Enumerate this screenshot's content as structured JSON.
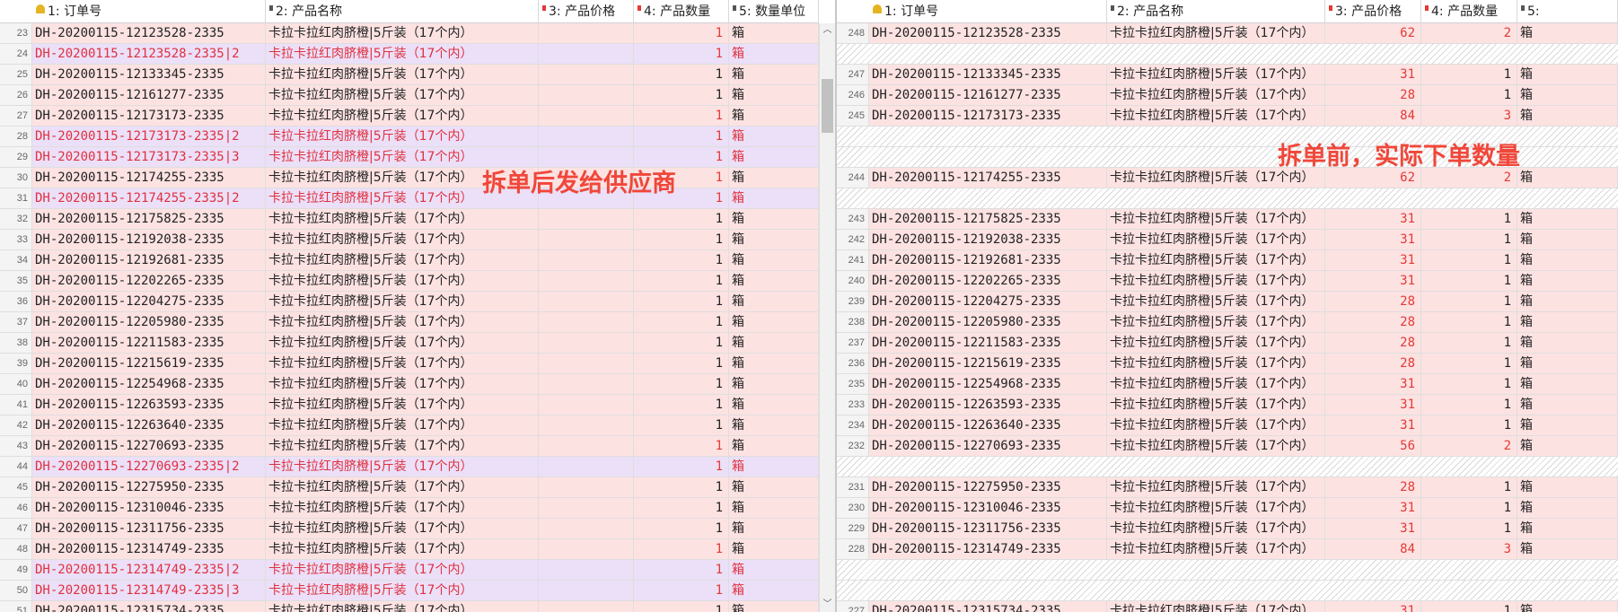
{
  "left": {
    "headers": [
      "1: 订单号",
      "2: 产品名称",
      "3: 产品价格",
      "4: 产品数量",
      "5: 数量单位"
    ],
    "rows": [
      {
        "n": "23",
        "order": "DH-20200115-12123528-2335",
        "name": "卡拉卡拉红肉脐橙|5斤装（17个内）",
        "price": "",
        "qty": "1",
        "unit": "箱",
        "split": false,
        "red_qty": true
      },
      {
        "n": "24",
        "order": "DH-20200115-12123528-2335|2",
        "name": "卡拉卡拉红肉脐橙|5斤装（17个内）",
        "price": "",
        "qty": "1",
        "unit": "箱",
        "split": true,
        "red_qty": true
      },
      {
        "n": "25",
        "order": "DH-20200115-12133345-2335",
        "name": "卡拉卡拉红肉脐橙|5斤装（17个内）",
        "price": "",
        "qty": "1",
        "unit": "箱",
        "split": false,
        "red_qty": false
      },
      {
        "n": "26",
        "order": "DH-20200115-12161277-2335",
        "name": "卡拉卡拉红肉脐橙|5斤装（17个内）",
        "price": "",
        "qty": "1",
        "unit": "箱",
        "split": false,
        "red_qty": false
      },
      {
        "n": "27",
        "order": "DH-20200115-12173173-2335",
        "name": "卡拉卡拉红肉脐橙|5斤装（17个内）",
        "price": "",
        "qty": "1",
        "unit": "箱",
        "split": false,
        "red_qty": true
      },
      {
        "n": "28",
        "order": "DH-20200115-12173173-2335|2",
        "name": "卡拉卡拉红肉脐橙|5斤装（17个内）",
        "price": "",
        "qty": "1",
        "unit": "箱",
        "split": true,
        "red_qty": true
      },
      {
        "n": "29",
        "order": "DH-20200115-12173173-2335|3",
        "name": "卡拉卡拉红肉脐橙|5斤装（17个内）",
        "price": "",
        "qty": "1",
        "unit": "箱",
        "split": true,
        "red_qty": true
      },
      {
        "n": "30",
        "order": "DH-20200115-12174255-2335",
        "name": "卡拉卡拉红肉脐橙|5斤装（17个内）",
        "price": "",
        "qty": "1",
        "unit": "箱",
        "split": false,
        "red_qty": true
      },
      {
        "n": "31",
        "order": "DH-20200115-12174255-2335|2",
        "name": "卡拉卡拉红肉脐橙|5斤装（17个内）",
        "price": "",
        "qty": "1",
        "unit": "箱",
        "split": true,
        "red_qty": true
      },
      {
        "n": "32",
        "order": "DH-20200115-12175825-2335",
        "name": "卡拉卡拉红肉脐橙|5斤装（17个内）",
        "price": "",
        "qty": "1",
        "unit": "箱",
        "split": false,
        "red_qty": false
      },
      {
        "n": "33",
        "order": "DH-20200115-12192038-2335",
        "name": "卡拉卡拉红肉脐橙|5斤装（17个内）",
        "price": "",
        "qty": "1",
        "unit": "箱",
        "split": false,
        "red_qty": false
      },
      {
        "n": "34",
        "order": "DH-20200115-12192681-2335",
        "name": "卡拉卡拉红肉脐橙|5斤装（17个内）",
        "price": "",
        "qty": "1",
        "unit": "箱",
        "split": false,
        "red_qty": false
      },
      {
        "n": "35",
        "order": "DH-20200115-12202265-2335",
        "name": "卡拉卡拉红肉脐橙|5斤装（17个内）",
        "price": "",
        "qty": "1",
        "unit": "箱",
        "split": false,
        "red_qty": false
      },
      {
        "n": "36",
        "order": "DH-20200115-12204275-2335",
        "name": "卡拉卡拉红肉脐橙|5斤装（17个内）",
        "price": "",
        "qty": "1",
        "unit": "箱",
        "split": false,
        "red_qty": false
      },
      {
        "n": "37",
        "order": "DH-20200115-12205980-2335",
        "name": "卡拉卡拉红肉脐橙|5斤装（17个内）",
        "price": "",
        "qty": "1",
        "unit": "箱",
        "split": false,
        "red_qty": false
      },
      {
        "n": "38",
        "order": "DH-20200115-12211583-2335",
        "name": "卡拉卡拉红肉脐橙|5斤装（17个内）",
        "price": "",
        "qty": "1",
        "unit": "箱",
        "split": false,
        "red_qty": false
      },
      {
        "n": "39",
        "order": "DH-20200115-12215619-2335",
        "name": "卡拉卡拉红肉脐橙|5斤装（17个内）",
        "price": "",
        "qty": "1",
        "unit": "箱",
        "split": false,
        "red_qty": false
      },
      {
        "n": "40",
        "order": "DH-20200115-12254968-2335",
        "name": "卡拉卡拉红肉脐橙|5斤装（17个内）",
        "price": "",
        "qty": "1",
        "unit": "箱",
        "split": false,
        "red_qty": false
      },
      {
        "n": "41",
        "order": "DH-20200115-12263593-2335",
        "name": "卡拉卡拉红肉脐橙|5斤装（17个内）",
        "price": "",
        "qty": "1",
        "unit": "箱",
        "split": false,
        "red_qty": false
      },
      {
        "n": "42",
        "order": "DH-20200115-12263640-2335",
        "name": "卡拉卡拉红肉脐橙|5斤装（17个内）",
        "price": "",
        "qty": "1",
        "unit": "箱",
        "split": false,
        "red_qty": false
      },
      {
        "n": "43",
        "order": "DH-20200115-12270693-2335",
        "name": "卡拉卡拉红肉脐橙|5斤装（17个内）",
        "price": "",
        "qty": "1",
        "unit": "箱",
        "split": false,
        "red_qty": true
      },
      {
        "n": "44",
        "order": "DH-20200115-12270693-2335|2",
        "name": "卡拉卡拉红肉脐橙|5斤装（17个内）",
        "price": "",
        "qty": "1",
        "unit": "箱",
        "split": true,
        "red_qty": true
      },
      {
        "n": "45",
        "order": "DH-20200115-12275950-2335",
        "name": "卡拉卡拉红肉脐橙|5斤装（17个内）",
        "price": "",
        "qty": "1",
        "unit": "箱",
        "split": false,
        "red_qty": false
      },
      {
        "n": "46",
        "order": "DH-20200115-12310046-2335",
        "name": "卡拉卡拉红肉脐橙|5斤装（17个内）",
        "price": "",
        "qty": "1",
        "unit": "箱",
        "split": false,
        "red_qty": false
      },
      {
        "n": "47",
        "order": "DH-20200115-12311756-2335",
        "name": "卡拉卡拉红肉脐橙|5斤装（17个内）",
        "price": "",
        "qty": "1",
        "unit": "箱",
        "split": false,
        "red_qty": false
      },
      {
        "n": "48",
        "order": "DH-20200115-12314749-2335",
        "name": "卡拉卡拉红肉脐橙|5斤装（17个内）",
        "price": "",
        "qty": "1",
        "unit": "箱",
        "split": false,
        "red_qty": true
      },
      {
        "n": "49",
        "order": "DH-20200115-12314749-2335|2",
        "name": "卡拉卡拉红肉脐橙|5斤装（17个内）",
        "price": "",
        "qty": "1",
        "unit": "箱",
        "split": true,
        "red_qty": true
      },
      {
        "n": "50",
        "order": "DH-20200115-12314749-2335|3",
        "name": "卡拉卡拉红肉脐橙|5斤装（17个内）",
        "price": "",
        "qty": "1",
        "unit": "箱",
        "split": true,
        "red_qty": true
      },
      {
        "n": "51",
        "order": "DH-20200115-12315734-2335",
        "name": "卡拉卡拉红肉脐橙|5斤装（17个内）",
        "price": "",
        "qty": "1",
        "unit": "箱",
        "split": false,
        "red_qty": false
      }
    ],
    "annotation": "拆单后发给供应商"
  },
  "right": {
    "headers": [
      "1: 订单号",
      "2: 产品名称",
      "3: 产品价格",
      "4: 产品数量",
      "5: "
    ],
    "rows": [
      {
        "n": "248",
        "order": "DH-20200115-12123528-2335",
        "name": "卡拉卡拉红肉脐橙|5斤装（17个内）",
        "price": "62",
        "qty": "2",
        "unit": "箱",
        "red_qty": true
      },
      {
        "gap": true
      },
      {
        "n": "247",
        "order": "DH-20200115-12133345-2335",
        "name": "卡拉卡拉红肉脐橙|5斤装（17个内）",
        "price": "31",
        "qty": "1",
        "unit": "箱",
        "red_qty": false
      },
      {
        "n": "246",
        "order": "DH-20200115-12161277-2335",
        "name": "卡拉卡拉红肉脐橙|5斤装（17个内）",
        "price": "28",
        "qty": "1",
        "unit": "箱",
        "red_qty": false
      },
      {
        "n": "245",
        "order": "DH-20200115-12173173-2335",
        "name": "卡拉卡拉红肉脐橙|5斤装（17个内）",
        "price": "84",
        "qty": "3",
        "unit": "箱",
        "red_qty": true
      },
      {
        "gap": true
      },
      {
        "gap": true
      },
      {
        "n": "244",
        "order": "DH-20200115-12174255-2335",
        "name": "卡拉卡拉红肉脐橙|5斤装（17个内）",
        "price": "62",
        "qty": "2",
        "unit": "箱",
        "red_qty": true
      },
      {
        "gap": true
      },
      {
        "n": "243",
        "order": "DH-20200115-12175825-2335",
        "name": "卡拉卡拉红肉脐橙|5斤装（17个内）",
        "price": "31",
        "qty": "1",
        "unit": "箱",
        "red_qty": false
      },
      {
        "n": "242",
        "order": "DH-20200115-12192038-2335",
        "name": "卡拉卡拉红肉脐橙|5斤装（17个内）",
        "price": "31",
        "qty": "1",
        "unit": "箱",
        "red_qty": false
      },
      {
        "n": "241",
        "order": "DH-20200115-12192681-2335",
        "name": "卡拉卡拉红肉脐橙|5斤装（17个内）",
        "price": "31",
        "qty": "1",
        "unit": "箱",
        "red_qty": false
      },
      {
        "n": "240",
        "order": "DH-20200115-12202265-2335",
        "name": "卡拉卡拉红肉脐橙|5斤装（17个内）",
        "price": "31",
        "qty": "1",
        "unit": "箱",
        "red_qty": false
      },
      {
        "n": "239",
        "order": "DH-20200115-12204275-2335",
        "name": "卡拉卡拉红肉脐橙|5斤装（17个内）",
        "price": "28",
        "qty": "1",
        "unit": "箱",
        "red_qty": false
      },
      {
        "n": "238",
        "order": "DH-20200115-12205980-2335",
        "name": "卡拉卡拉红肉脐橙|5斤装（17个内）",
        "price": "28",
        "qty": "1",
        "unit": "箱",
        "red_qty": false
      },
      {
        "n": "237",
        "order": "DH-20200115-12211583-2335",
        "name": "卡拉卡拉红肉脐橙|5斤装（17个内）",
        "price": "28",
        "qty": "1",
        "unit": "箱",
        "red_qty": false
      },
      {
        "n": "236",
        "order": "DH-20200115-12215619-2335",
        "name": "卡拉卡拉红肉脐橙|5斤装（17个内）",
        "price": "28",
        "qty": "1",
        "unit": "箱",
        "red_qty": false
      },
      {
        "n": "235",
        "order": "DH-20200115-12254968-2335",
        "name": "卡拉卡拉红肉脐橙|5斤装（17个内）",
        "price": "31",
        "qty": "1",
        "unit": "箱",
        "red_qty": false
      },
      {
        "n": "233",
        "order": "DH-20200115-12263593-2335",
        "name": "卡拉卡拉红肉脐橙|5斤装（17个内）",
        "price": "31",
        "qty": "1",
        "unit": "箱",
        "red_qty": false
      },
      {
        "n": "234",
        "order": "DH-20200115-12263640-2335",
        "name": "卡拉卡拉红肉脐橙|5斤装（17个内）",
        "price": "31",
        "qty": "1",
        "unit": "箱",
        "red_qty": false
      },
      {
        "n": "232",
        "order": "DH-20200115-12270693-2335",
        "name": "卡拉卡拉红肉脐橙|5斤装（17个内）",
        "price": "56",
        "qty": "2",
        "unit": "箱",
        "red_qty": true
      },
      {
        "gap": true
      },
      {
        "n": "231",
        "order": "DH-20200115-12275950-2335",
        "name": "卡拉卡拉红肉脐橙|5斤装（17个内）",
        "price": "28",
        "qty": "1",
        "unit": "箱",
        "red_qty": false
      },
      {
        "n": "230",
        "order": "DH-20200115-12310046-2335",
        "name": "卡拉卡拉红肉脐橙|5斤装（17个内）",
        "price": "31",
        "qty": "1",
        "unit": "箱",
        "red_qty": false
      },
      {
        "n": "229",
        "order": "DH-20200115-12311756-2335",
        "name": "卡拉卡拉红肉脐橙|5斤装（17个内）",
        "price": "31",
        "qty": "1",
        "unit": "箱",
        "red_qty": false
      },
      {
        "n": "228",
        "order": "DH-20200115-12314749-2335",
        "name": "卡拉卡拉红肉脐橙|5斤装（17个内）",
        "price": "84",
        "qty": "3",
        "unit": "箱",
        "red_qty": true
      },
      {
        "gap": true
      },
      {
        "gap": true
      },
      {
        "n": "227",
        "order": "DH-20200115-12315734-2335",
        "name": "卡拉卡拉红肉脐橙|5斤装（17个内）",
        "price": "31",
        "qty": "1",
        "unit": "箱",
        "red_qty": false
      }
    ],
    "annotation": "拆单前，实际下单数量"
  },
  "colors": {
    "row_bg": "#fde2e2",
    "split_row_bg": "#ebe0f8",
    "split_text": "#e0303e",
    "red_value": "#e53935",
    "annotation": "#f0473a"
  },
  "icons": {
    "key_column": "key-icon",
    "column_marker": "column-marker-icon",
    "scroll_up": "scroll-up-arrow-icon",
    "scroll_down": "scroll-down-arrow-icon"
  }
}
